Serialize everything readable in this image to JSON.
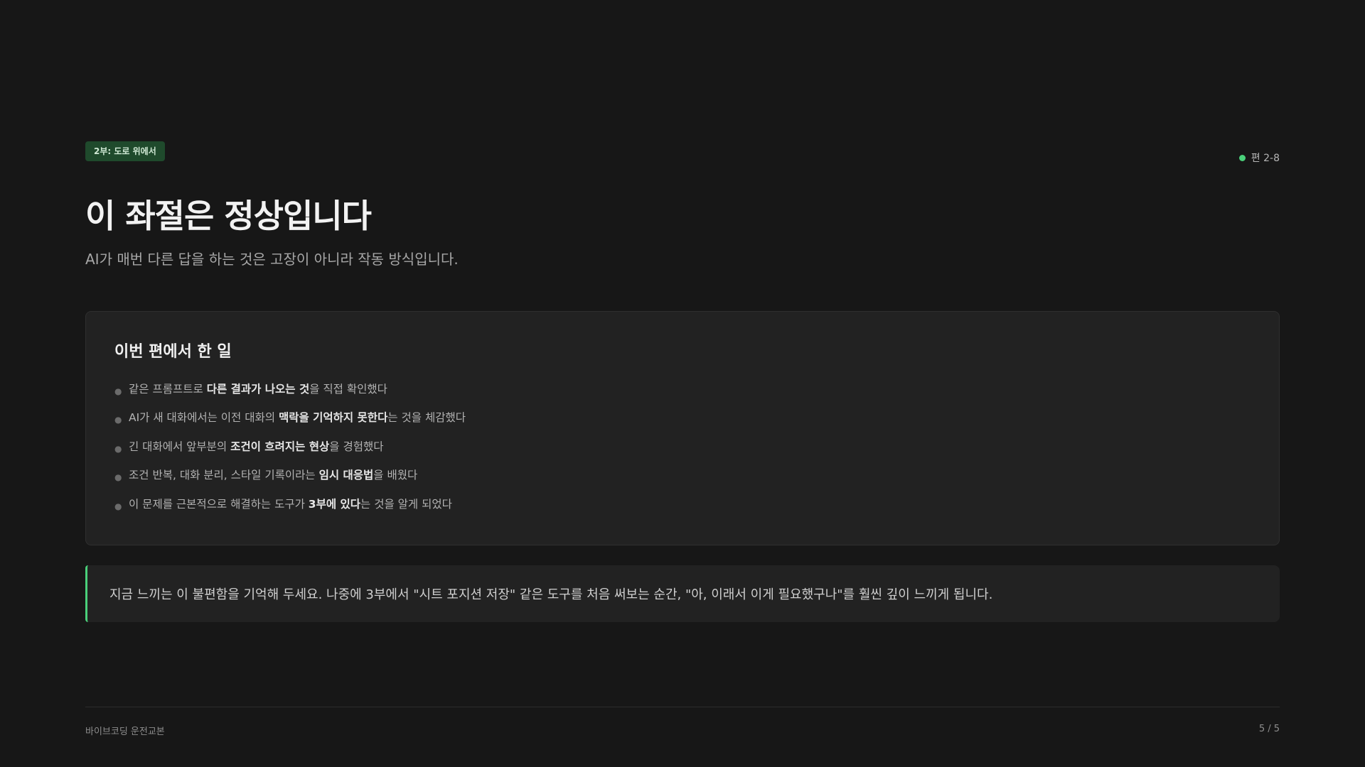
{
  "header": {
    "badge": "2부: 도로 위에서",
    "episode": "편 2-8",
    "status_dot_color": "#4ad07a"
  },
  "title": "이 좌절은 정상입니다",
  "subtitle": "AI가 매번 다른 답을 하는 것은 고장이 아니라 작동 방식입니다.",
  "summary": {
    "heading": "이번 편에서 한 일",
    "items": [
      {
        "pre": "같은 프롬프트로 ",
        "bold": "다른 결과가 나오는 것",
        "post": "을 직접 확인했다"
      },
      {
        "pre": "AI가 새 대화에서는 이전 대화의 ",
        "bold": "맥락을 기억하지 못한다",
        "post": "는 것을 체감했다"
      },
      {
        "pre": "긴 대화에서 앞부분의 ",
        "bold": "조건이 흐려지는 현상",
        "post": "을 경험했다"
      },
      {
        "pre": "조건 반복, 대화 분리, 스타일 기록이라는 ",
        "bold": "임시 대응법",
        "post": "을 배웠다"
      },
      {
        "pre": "이 문제를 근본적으로 해결하는 도구가 ",
        "bold": "3부에 있다",
        "post": "는 것을 알게 되었다"
      }
    ]
  },
  "callout": {
    "text": "지금 느끼는 이 불편함을 기억해 두세요. 나중에 3부에서 \"시트 포지션 저장\" 같은 도구를 처음 써보는 순간, \"아, 이래서 이게 필요했구나\"를 훨씬 깊이 느끼게 됩니다.",
    "accent_color": "#4ad07a"
  },
  "footer": {
    "book_title": "바이브코딩 운전교본",
    "page_indicator": "5 / 5"
  }
}
